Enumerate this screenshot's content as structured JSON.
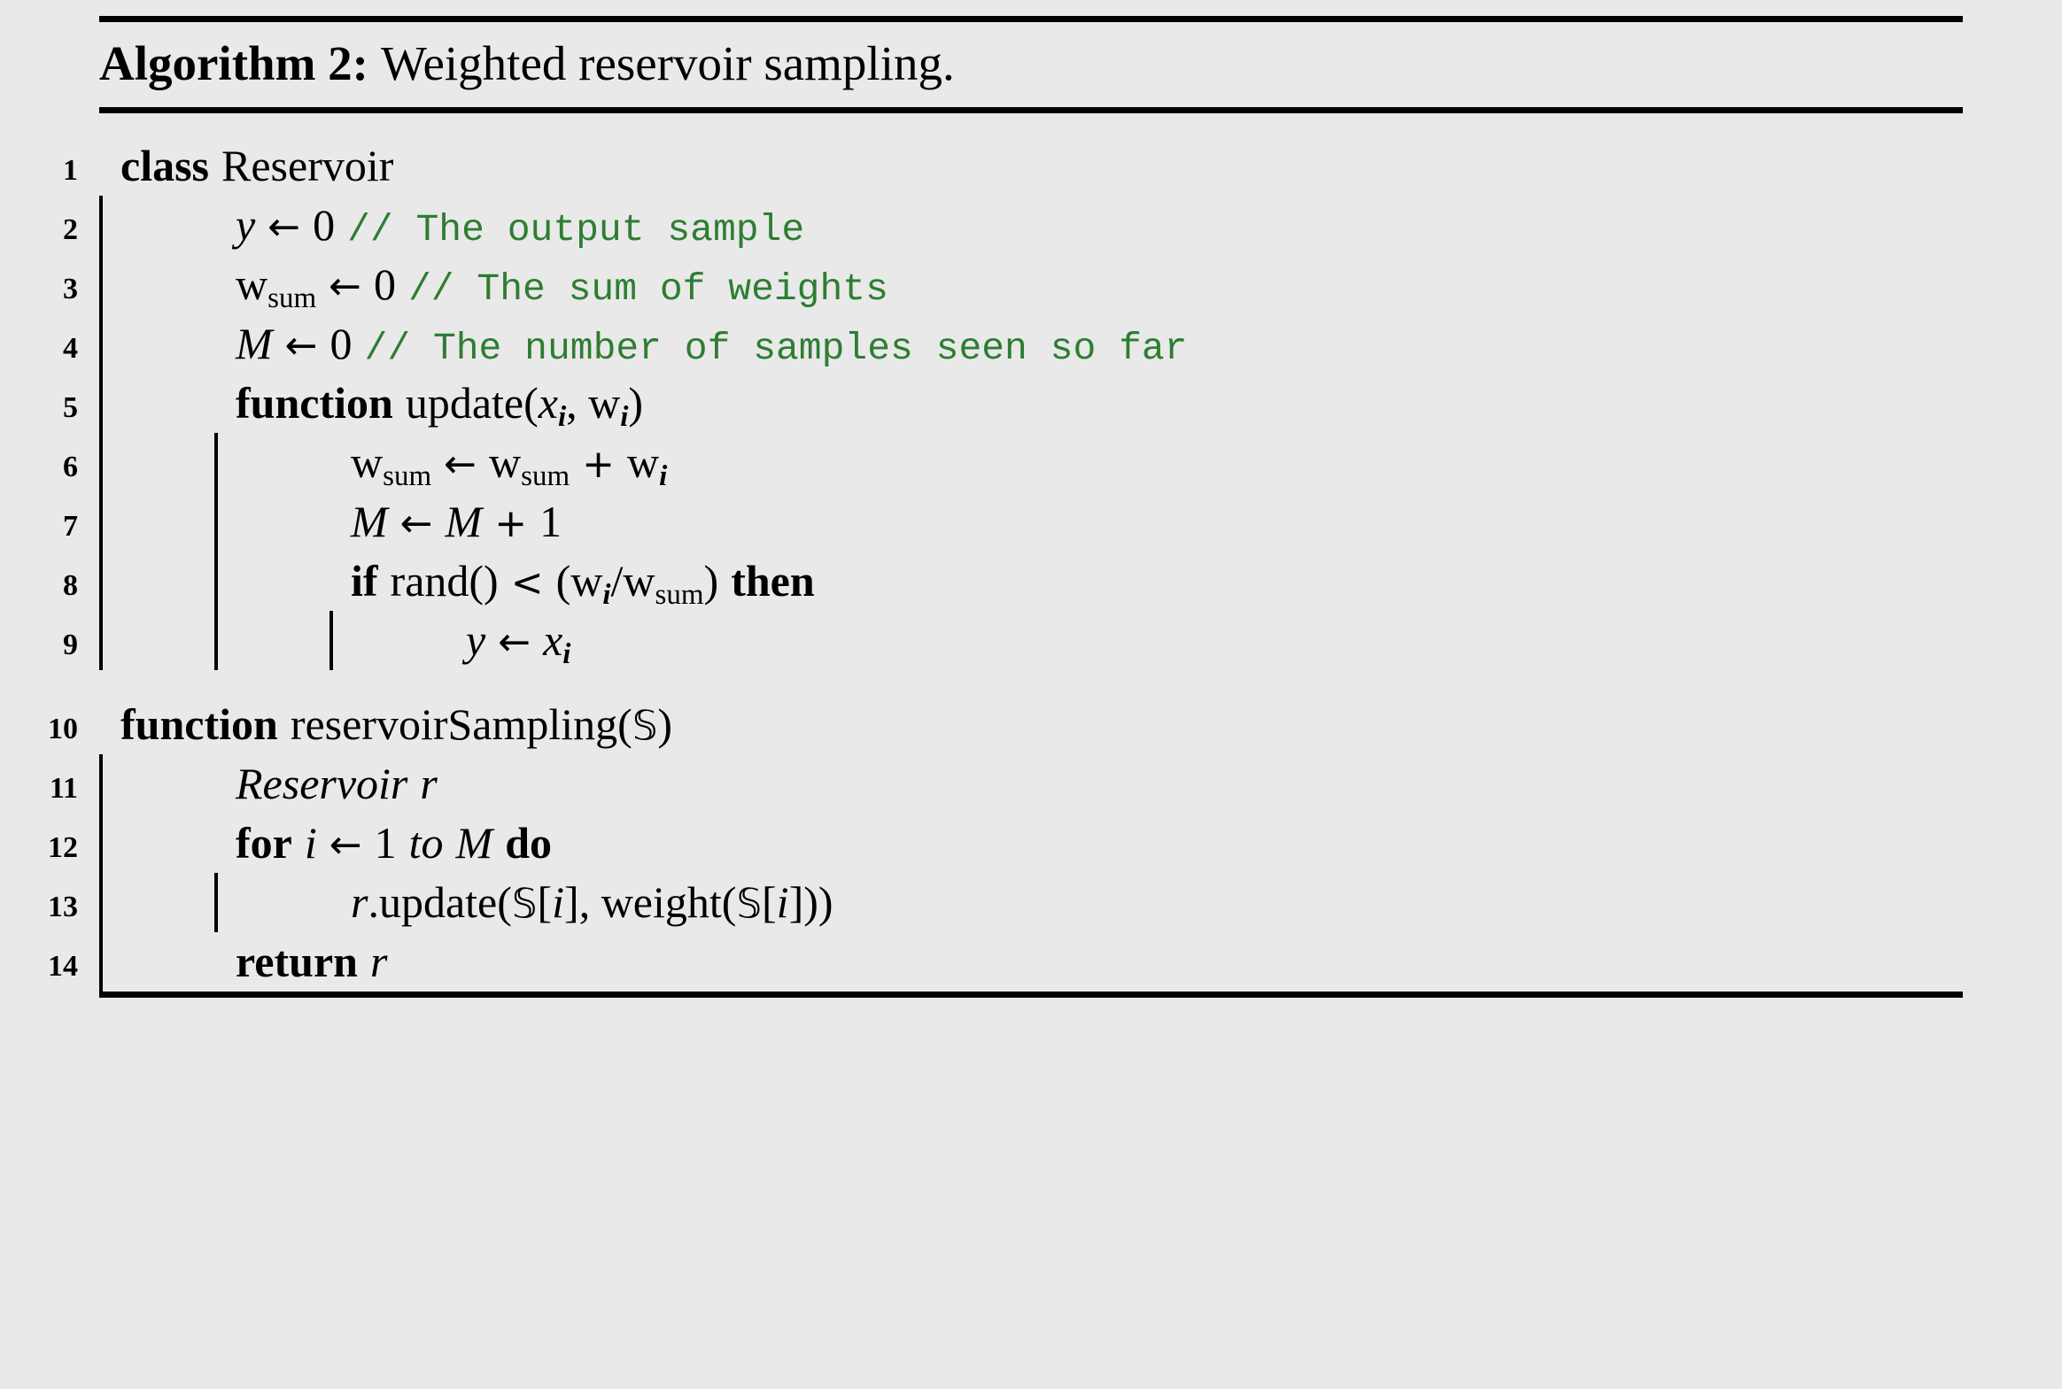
{
  "caption": {
    "label": "Algorithm 2:",
    "title": "Weighted reservoir sampling."
  },
  "symbols": {
    "arrow": "←",
    "less_than": "<",
    "plus": "+",
    "slash": "/",
    "blackboard_s": "𝕊"
  },
  "colors": {
    "background": "#e9e9e9",
    "text": "#000000",
    "comment": "#2e7d32"
  },
  "lines": [
    {
      "no": "1",
      "indent": 0,
      "guides": [],
      "tokens": [
        {
          "t": "class",
          "s": "kw"
        },
        {
          "t": " ",
          "s": "sp"
        },
        {
          "t": "Reservoir",
          "s": "rm"
        }
      ]
    },
    {
      "no": "2",
      "indent": 1,
      "guides": [
        1
      ],
      "tokens": [
        {
          "t": "y",
          "s": "mi"
        },
        {
          "t": " ",
          "s": "sp"
        },
        {
          "t": "←",
          "s": "arrow"
        },
        {
          "t": " ",
          "s": "sp"
        },
        {
          "t": "0",
          "s": "rm"
        },
        {
          "t": " ",
          "s": "sp"
        },
        {
          "t": "// The output sample",
          "s": "cmt"
        }
      ]
    },
    {
      "no": "3",
      "indent": 1,
      "guides": [
        1
      ],
      "tokens": [
        {
          "t": "w",
          "s": "rm"
        },
        {
          "t": "sum",
          "s": "sub"
        },
        {
          "t": " ",
          "s": "sp"
        },
        {
          "t": "←",
          "s": "arrow"
        },
        {
          "t": " ",
          "s": "sp"
        },
        {
          "t": "0",
          "s": "rm"
        },
        {
          "t": " ",
          "s": "sp"
        },
        {
          "t": "// The sum of weights",
          "s": "cmt"
        }
      ]
    },
    {
      "no": "4",
      "indent": 1,
      "guides": [
        1
      ],
      "tokens": [
        {
          "t": "M",
          "s": "mi"
        },
        {
          "t": " ",
          "s": "sp"
        },
        {
          "t": "←",
          "s": "arrow"
        },
        {
          "t": " ",
          "s": "sp"
        },
        {
          "t": "0",
          "s": "rm"
        },
        {
          "t": " ",
          "s": "sp"
        },
        {
          "t": "// The number of samples seen so far",
          "s": "cmt"
        }
      ]
    },
    {
      "no": "5",
      "indent": 1,
      "guides": [
        1
      ],
      "tokens": [
        {
          "t": "function",
          "s": "kw"
        },
        {
          "t": " ",
          "s": "sp"
        },
        {
          "t": "update(",
          "s": "rm"
        },
        {
          "t": "x",
          "s": "mi"
        },
        {
          "t": "i",
          "s": "subit"
        },
        {
          "t": ", ",
          "s": "rm"
        },
        {
          "t": "w",
          "s": "rm"
        },
        {
          "t": "i",
          "s": "subit"
        },
        {
          "t": ")",
          "s": "rm"
        }
      ]
    },
    {
      "no": "6",
      "indent": 2,
      "guides": [
        1,
        2
      ],
      "tokens": [
        {
          "t": "w",
          "s": "rm"
        },
        {
          "t": "sum",
          "s": "sub"
        },
        {
          "t": " ",
          "s": "sp"
        },
        {
          "t": "←",
          "s": "arrow"
        },
        {
          "t": " ",
          "s": "sp"
        },
        {
          "t": "w",
          "s": "rm"
        },
        {
          "t": "sum",
          "s": "sub"
        },
        {
          "t": " ",
          "s": "sp"
        },
        {
          "t": "+",
          "s": "op"
        },
        {
          "t": " ",
          "s": "sp"
        },
        {
          "t": "w",
          "s": "rm"
        },
        {
          "t": "i",
          "s": "subit"
        }
      ]
    },
    {
      "no": "7",
      "indent": 2,
      "guides": [
        1,
        2
      ],
      "tokens": [
        {
          "t": "M",
          "s": "mi"
        },
        {
          "t": " ",
          "s": "sp"
        },
        {
          "t": "←",
          "s": "arrow"
        },
        {
          "t": " ",
          "s": "sp"
        },
        {
          "t": "M",
          "s": "mi"
        },
        {
          "t": " ",
          "s": "sp"
        },
        {
          "t": "+",
          "s": "op"
        },
        {
          "t": " ",
          "s": "sp"
        },
        {
          "t": "1",
          "s": "rm"
        }
      ]
    },
    {
      "no": "8",
      "indent": 2,
      "guides": [
        1,
        2
      ],
      "tokens": [
        {
          "t": "if",
          "s": "kw"
        },
        {
          "t": " ",
          "s": "sp"
        },
        {
          "t": "rand()",
          "s": "rm"
        },
        {
          "t": " ",
          "s": "sp"
        },
        {
          "t": "<",
          "s": "op"
        },
        {
          "t": " ",
          "s": "sp"
        },
        {
          "t": "(",
          "s": "rm"
        },
        {
          "t": "w",
          "s": "rm"
        },
        {
          "t": "i",
          "s": "subit"
        },
        {
          "t": "/",
          "s": "rm"
        },
        {
          "t": "w",
          "s": "rm"
        },
        {
          "t": "sum",
          "s": "sub"
        },
        {
          "t": ")",
          "s": "rm"
        },
        {
          "t": " ",
          "s": "sp"
        },
        {
          "t": "then",
          "s": "kw"
        }
      ]
    },
    {
      "no": "9",
      "indent": 3,
      "guides": [
        1,
        2,
        3
      ],
      "tokens": [
        {
          "t": "y",
          "s": "mi"
        },
        {
          "t": " ",
          "s": "sp"
        },
        {
          "t": "←",
          "s": "arrow"
        },
        {
          "t": " ",
          "s": "sp"
        },
        {
          "t": "x",
          "s": "mi"
        },
        {
          "t": "i",
          "s": "subit"
        }
      ]
    },
    {
      "no": "10",
      "indent": 0,
      "guides": [],
      "gap_before": true,
      "tokens": [
        {
          "t": "function",
          "s": "kw"
        },
        {
          "t": " ",
          "s": "sp"
        },
        {
          "t": "reservoirSampling(",
          "s": "rm"
        },
        {
          "t": "𝕊",
          "s": "bb"
        },
        {
          "t": ")",
          "s": "rm"
        }
      ]
    },
    {
      "no": "11",
      "indent": 1,
      "guides": [
        1
      ],
      "tokens": [
        {
          "t": "Reservoir",
          "s": "it"
        },
        {
          "t": " ",
          "s": "sp"
        },
        {
          "t": "r",
          "s": "mi"
        }
      ]
    },
    {
      "no": "12",
      "indent": 1,
      "guides": [
        1
      ],
      "tokens": [
        {
          "t": "for",
          "s": "kw"
        },
        {
          "t": " ",
          "s": "sp"
        },
        {
          "t": "i",
          "s": "mi"
        },
        {
          "t": " ",
          "s": "sp"
        },
        {
          "t": "←",
          "s": "arrow"
        },
        {
          "t": " ",
          "s": "sp"
        },
        {
          "t": "1",
          "s": "rm"
        },
        {
          "t": " ",
          "s": "sp"
        },
        {
          "t": "to",
          "s": "it"
        },
        {
          "t": " ",
          "s": "sp"
        },
        {
          "t": "M",
          "s": "mi"
        },
        {
          "t": " ",
          "s": "sp"
        },
        {
          "t": "do",
          "s": "kw"
        }
      ]
    },
    {
      "no": "13",
      "indent": 2,
      "guides": [
        1,
        2
      ],
      "tokens": [
        {
          "t": "r",
          "s": "mi"
        },
        {
          "t": ".update(",
          "s": "rm"
        },
        {
          "t": "𝕊",
          "s": "bb"
        },
        {
          "t": "[",
          "s": "rm"
        },
        {
          "t": "i",
          "s": "mi"
        },
        {
          "t": "], weight(",
          "s": "rm"
        },
        {
          "t": "𝕊",
          "s": "bb"
        },
        {
          "t": "[",
          "s": "rm"
        },
        {
          "t": "i",
          "s": "mi"
        },
        {
          "t": "]))",
          "s": "rm"
        }
      ]
    },
    {
      "no": "14",
      "indent": 1,
      "guides": [
        1
      ],
      "tokens": [
        {
          "t": "return",
          "s": "kw"
        },
        {
          "t": " ",
          "s": "sp"
        },
        {
          "t": "r",
          "s": "mi"
        }
      ]
    }
  ]
}
